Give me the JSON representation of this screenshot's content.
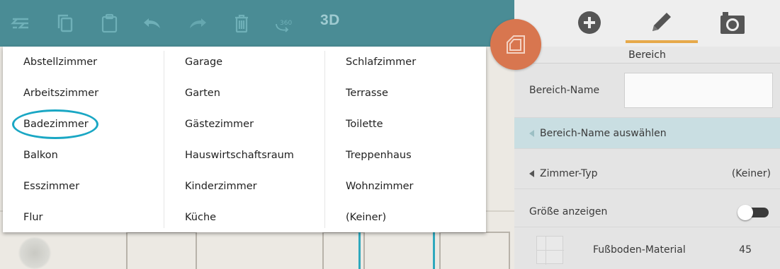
{
  "toolbar": {
    "icons": [
      "layers-icon",
      "copy-icon",
      "paste-icon",
      "undo-icon",
      "redo-icon",
      "trash-icon",
      "rotate-360-icon"
    ],
    "label_3d": "3D",
    "color": "#4a8c95"
  },
  "fab": {
    "icon": "room-icon",
    "color": "#d8764f"
  },
  "dropdown": {
    "columns": [
      [
        "Abstellzimmer",
        "Arbeitszimmer",
        "Badezimmer",
        "Balkon",
        "Esszimmer",
        "Flur"
      ],
      [
        "Garage",
        "Garten",
        "Gästezimmer",
        "Hauswirtschaftsraum",
        "Kinderzimmer",
        "Küche"
      ],
      [
        "Schlafzimmer",
        "Terrasse",
        "Toilette",
        "Treppenhaus",
        "Wohnzimmer",
        "(Keiner)"
      ]
    ],
    "highlighted": "Badezimmer",
    "highlight_color": "#1aa7c4"
  },
  "panel": {
    "tabs": [
      "add-icon",
      "pencil-icon",
      "camera-icon"
    ],
    "active_tab": "pencil-icon",
    "active_color": "#e6a94a",
    "header": "Bereich",
    "name_label": "Bereich-Name",
    "name_value": "",
    "select_name": "Bereich-Name auswählen",
    "room_type_label": "Zimmer-Typ",
    "room_type_value": "(Keiner)",
    "show_size_label": "Größe anzeigen",
    "show_size_on": true,
    "floor_material_label": "Fußboden-Material",
    "floor_material_value": "45"
  }
}
